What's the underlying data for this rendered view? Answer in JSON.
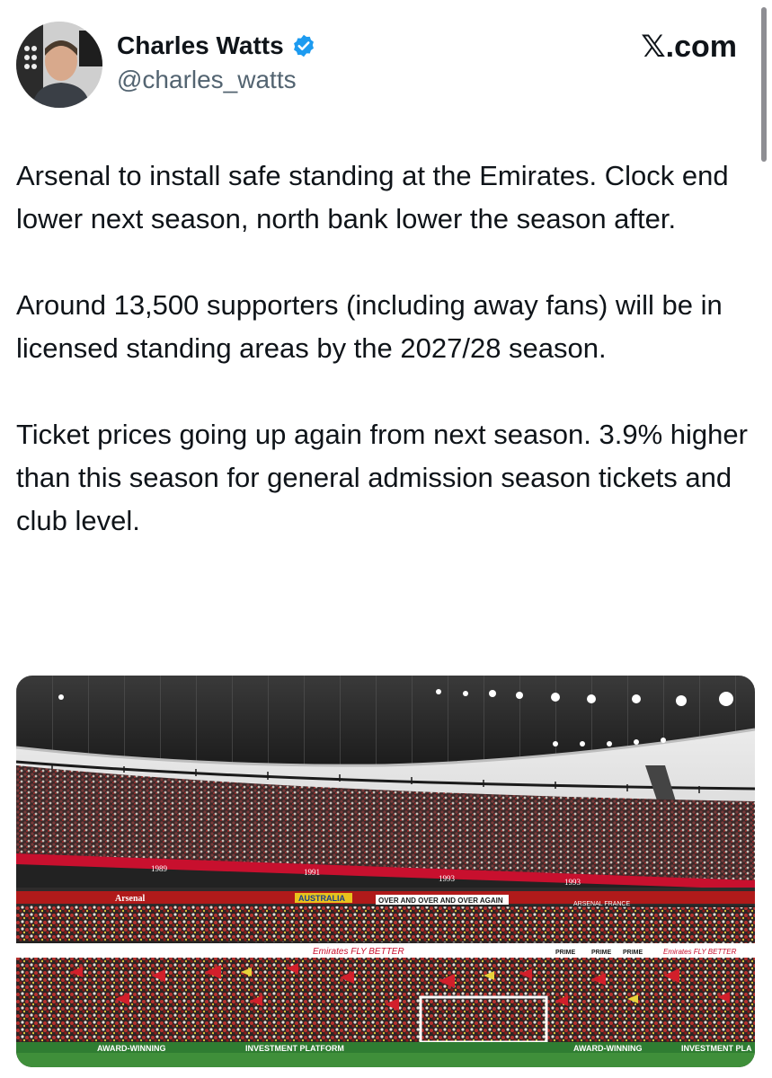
{
  "author": {
    "display_name": "Charles Watts",
    "handle": "@charles_watts",
    "verified_icon": "verified-badge-icon",
    "verified_color": "#1d9bf0"
  },
  "site_mark": "𝕏.com",
  "tweet": {
    "paragraphs": [
      "Arsenal to install safe standing at the Emirates. Clock end lower next season, north bank lower the season after.",
      "Around 13,500 supporters (including away fans) will be in licensed standing areas by the 2027/28 season.",
      "Ticket prices going up again from next season. 3.9% higher than this season for general admission season tickets and club level."
    ]
  },
  "media": {
    "banners": {
      "years_1": "1989",
      "years_2": "1991",
      "years_3": "1993",
      "years_4": "1993",
      "arsenal": "Arsenal",
      "australia": "AUSTRALIA",
      "over_and_over": "OVER AND OVER AND OVER AGAIN",
      "arsenal_france": "ARSENAL FRANCE",
      "emirates_1": "Emirates FLY BETTER",
      "emirates_2": "Emirates FLY BETTER",
      "prime_1": "PRIME",
      "prime_2": "PRIME",
      "prime_3": "PRIME",
      "award_1": "AWARD-WINNING",
      "investment_1": "INVESTMENT PLATFORM",
      "award_2": "AWARD-WINNING",
      "investment_2": "INVESTMENT PLA"
    },
    "colors": {
      "arsenal_red": "#c8102e",
      "pitch_green": "#3f8f3a"
    }
  }
}
